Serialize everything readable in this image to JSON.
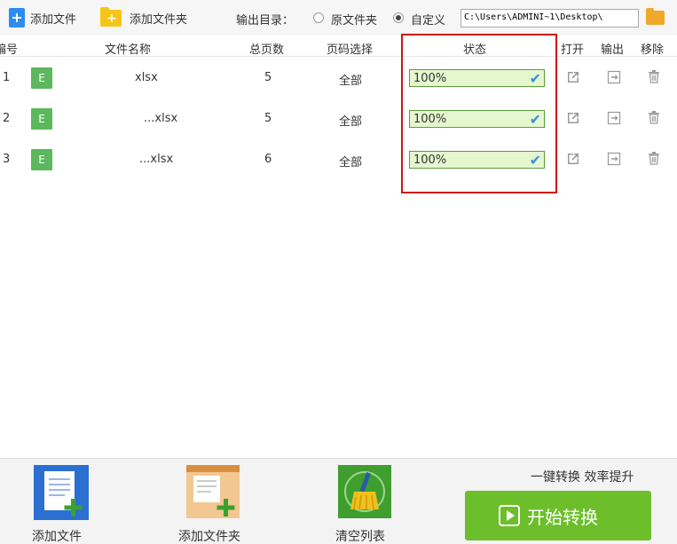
{
  "toolbar": {
    "add_file": "添加文件",
    "add_folder": "添加文件夹",
    "output_dir_label": "输出目录：",
    "radio_original": "原文件夹",
    "radio_custom": "自定义",
    "output_path": "C:\\Users\\ADMINI~1\\Desktop\\"
  },
  "columns": {
    "index": "编号",
    "name": "文件名称",
    "pages": "总页数",
    "page_select": "页码选择",
    "status": "状态",
    "open": "打开",
    "export": "输出",
    "remove": "移除"
  },
  "rows": [
    {
      "index": "1",
      "type": "E",
      "name": "xlsx",
      "pages": "5",
      "page_select": "全部",
      "status": "100%",
      "progress": 1.0
    },
    {
      "index": "2",
      "type": "E",
      "name": "...xlsx",
      "pages": "5",
      "page_select": "全部",
      "status": "100%",
      "progress": 1.0
    },
    {
      "index": "3",
      "type": "E",
      "name": "...xlsx",
      "pages": "6",
      "page_select": "全部",
      "status": "100%",
      "progress": 1.0
    }
  ],
  "bottom": {
    "add_file": "添加文件",
    "add_folder": "添加文件夹",
    "clear_list": "清空列表",
    "slogan": "一键转换  效率提升",
    "start": "开始转换"
  },
  "colors": {
    "progress_fill": "#e5f7cf",
    "check": "#3d8fe0",
    "start_button": "#6cbf2a",
    "highlight": "#d0141c"
  }
}
